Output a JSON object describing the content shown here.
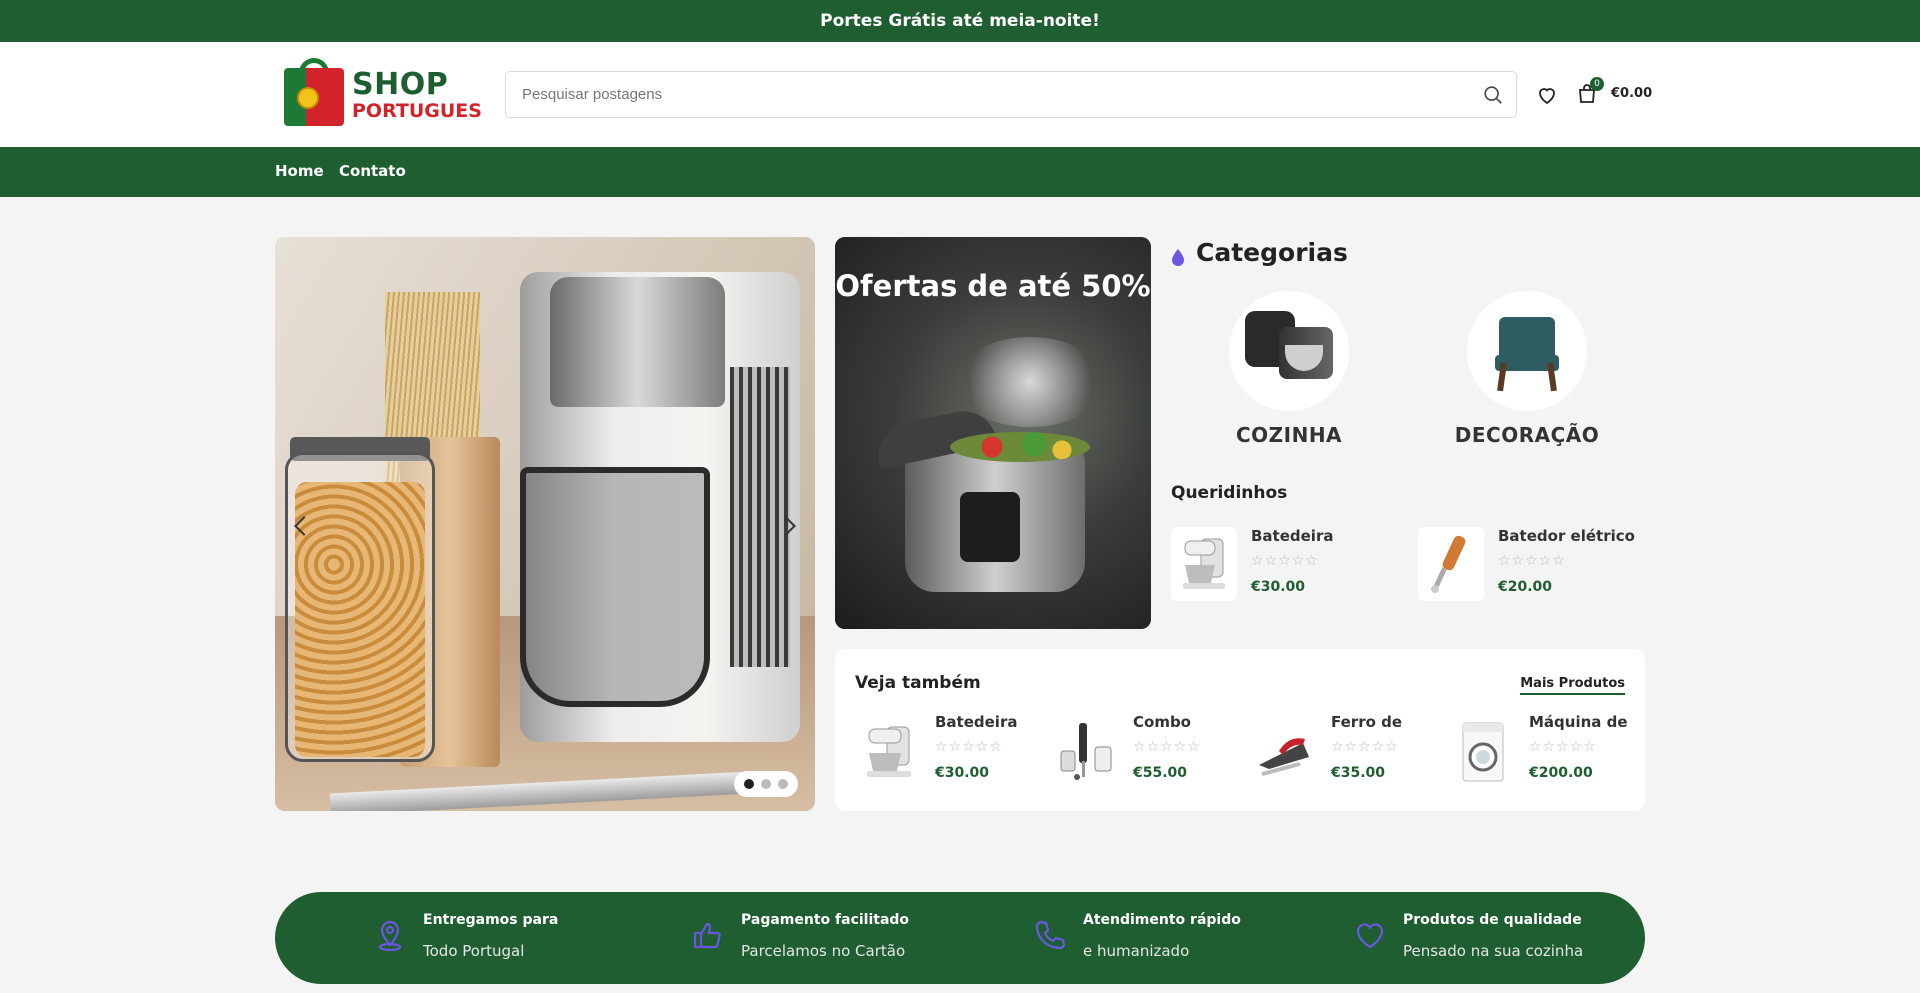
{
  "topbar": {
    "text": "Portes Grátis até meia-noite!"
  },
  "logo": {
    "line1": "SHOP",
    "line2": "PORTUGUES"
  },
  "search": {
    "placeholder": "Pesquisar postagens"
  },
  "cart": {
    "count": "0",
    "total": "€0.00"
  },
  "nav": {
    "items": [
      {
        "label": "Home"
      },
      {
        "label": "Contato"
      }
    ]
  },
  "hero": {
    "slides": 3,
    "active_slide": 1
  },
  "promo": {
    "title": "Ofertas de até 50%"
  },
  "categories": {
    "title": "Categorias",
    "items": [
      {
        "label": "COZINHA"
      },
      {
        "label": "DECORAÇÃO"
      }
    ]
  },
  "favorites": {
    "title": "Queridinhos",
    "items": [
      {
        "name": "Batedeira",
        "rating": "☆☆☆☆☆",
        "price": "€30.00"
      },
      {
        "name": "Batedor elétrico",
        "rating": "☆☆☆☆☆",
        "price": "€20.00"
      }
    ]
  },
  "see_also": {
    "title": "Veja também",
    "more_label": "Mais Produtos",
    "items": [
      {
        "name": "Batedeira",
        "rating": "☆☆☆☆☆",
        "price": "€30.00"
      },
      {
        "name": "Combo",
        "rating": "☆☆☆☆☆",
        "price": "€55.00"
      },
      {
        "name": "Ferro de",
        "rating": "☆☆☆☆☆",
        "price": "€35.00"
      },
      {
        "name": "Máquina de",
        "rating": "☆☆☆☆☆",
        "price": "€200.00"
      }
    ]
  },
  "features": [
    {
      "icon": "location-pin-icon",
      "title": "Entregamos para",
      "subtitle": "Todo Portugal"
    },
    {
      "icon": "thumbs-up-icon",
      "title": "Pagamento facilitado",
      "subtitle": "Parcelamos no Cartão"
    },
    {
      "icon": "phone-icon",
      "title": "Atendimento rápido",
      "subtitle": "e humanizado"
    },
    {
      "icon": "heart-icon",
      "title": "Produtos de qualidade",
      "subtitle": "Pensado na sua cozinha"
    }
  ],
  "colors": {
    "brand_green": "#1e5e30",
    "brand_red": "#d2232a",
    "accent_purple": "#6b57e3"
  }
}
